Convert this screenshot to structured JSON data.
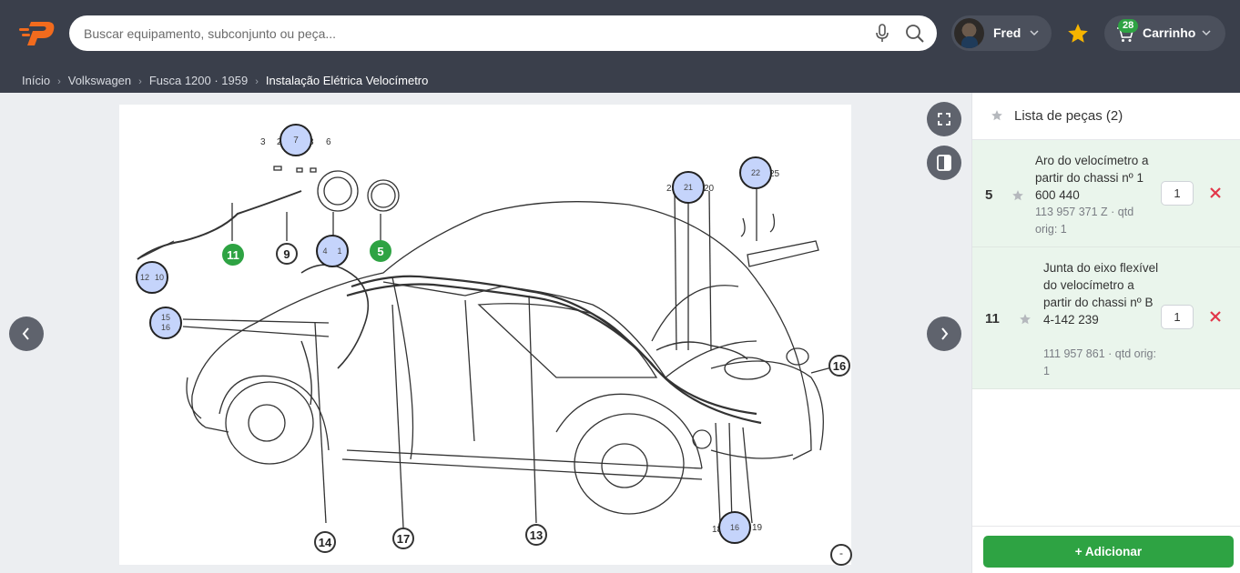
{
  "brand": {
    "accent": "#f26b1d",
    "topbar_bg": "#3a3f4b",
    "success": "#2ea343",
    "danger": "#e2374a"
  },
  "search": {
    "placeholder": "Buscar equipamento, subconjunto ou peça..."
  },
  "user": {
    "name": "Fred"
  },
  "cart": {
    "label": "Carrinho",
    "count": "28"
  },
  "breadcrumb": {
    "items": [
      "Início",
      "Volkswagen",
      "Fusca 1200 · 1959"
    ],
    "current": "Instalação Elétrica Velocímetro"
  },
  "diagram": {
    "markers": [
      {
        "label": "11",
        "style": "green"
      },
      {
        "label": "9",
        "style": "white"
      },
      {
        "label": "5",
        "style": "green"
      },
      {
        "label": "16",
        "style": "white"
      },
      {
        "label": "14",
        "style": "white"
      },
      {
        "label": "17",
        "style": "white"
      },
      {
        "label": "13",
        "style": "white"
      }
    ],
    "highlight_markers": [
      {
        "labels": [
          "7"
        ]
      },
      {
        "labels": [
          "4",
          "1"
        ]
      },
      {
        "labels": [
          "12",
          "10"
        ]
      },
      {
        "labels": [
          "15",
          "16"
        ]
      },
      {
        "labels": [
          "21"
        ]
      },
      {
        "labels": [
          "22"
        ]
      },
      {
        "labels": [
          "16"
        ]
      }
    ],
    "printed_numbers": [
      "3",
      "2",
      "8",
      "6",
      "23",
      "20",
      "25",
      "18",
      "19"
    ],
    "zoom_label": "-"
  },
  "parts_list": {
    "title": "Lista de peças (2)",
    "items": [
      {
        "ref": "5",
        "name": "Aro do velocímetro a partir do chassi nº 1 600 440",
        "meta": "113 957 371 Z · qtd orig: 1",
        "qty": "1"
      },
      {
        "ref": "11",
        "name": "Junta do eixo flexível do velocímetro a partir do chassi nº B 4-142 239",
        "meta": "111 957 861 · qtd orig: 1",
        "qty": "1"
      }
    ],
    "add_label": "+ Adicionar"
  },
  "icons": [
    "logo-icon",
    "mic-icon",
    "search-icon",
    "chevron-down-icon",
    "star-icon",
    "cart-icon",
    "fullscreen-icon",
    "split-view-icon",
    "chevron-left-icon",
    "chevron-right-icon",
    "remove-icon"
  ]
}
